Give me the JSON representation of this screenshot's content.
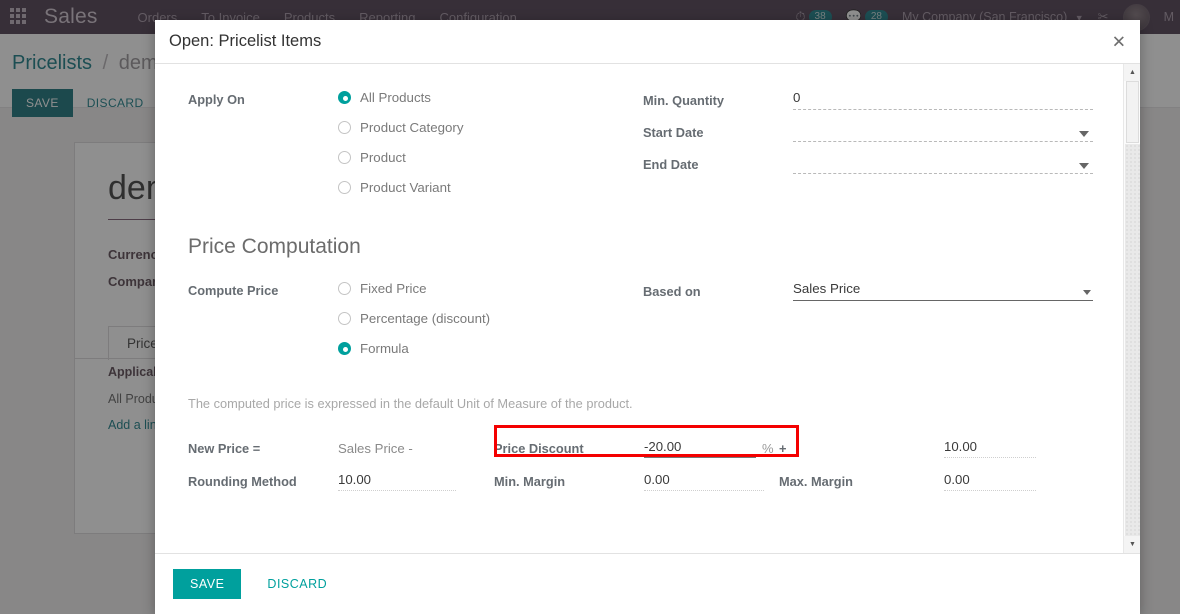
{
  "topbar": {
    "apps_icon": "apps-grid-icon",
    "brand": "Sales",
    "menu": [
      "Orders",
      "To Invoice",
      "Products",
      "Reporting",
      "Configuration"
    ],
    "activity_count": "38",
    "messages_count": "28",
    "company": "My Company (San Francisco)",
    "shortcut_glyph": "✂",
    "user": "M"
  },
  "breadcrumb": {
    "root": "Pricelists",
    "separator": "/",
    "current": "demo",
    "save_label": "SAVE",
    "discard_label": "DISCARD"
  },
  "record": {
    "title": "demo",
    "currency_label": "Currency",
    "company_label": "Company",
    "tab_label": "Price Rules",
    "column_header": "Applicable On",
    "row_value": "All Products",
    "add_line": "Add a line",
    "trash_icon": "trash-icon"
  },
  "modal": {
    "title": "Open: Pricelist Items",
    "close_icon": "close-icon",
    "apply_on": {
      "label": "Apply On",
      "options": [
        {
          "label": "All Products",
          "selected": true
        },
        {
          "label": "Product Category",
          "selected": false
        },
        {
          "label": "Product",
          "selected": false
        },
        {
          "label": "Product Variant",
          "selected": false
        }
      ]
    },
    "min_quantity": {
      "label": "Min. Quantity",
      "value": "0"
    },
    "start_date": {
      "label": "Start Date",
      "value": "",
      "dropdown_icon": "calendar-dropdown-icon"
    },
    "end_date": {
      "label": "End Date",
      "value": "",
      "dropdown_icon": "calendar-dropdown-icon"
    },
    "price_computation": {
      "section_title": "Price Computation",
      "compute_price": {
        "label": "Compute Price",
        "options": [
          {
            "label": "Fixed Price",
            "selected": false
          },
          {
            "label": "Percentage (discount)",
            "selected": false
          },
          {
            "label": "Formula",
            "selected": true
          }
        ]
      },
      "based_on": {
        "label": "Based on",
        "value": "Sales Price",
        "dropdown_icon": "chevron-down-icon"
      },
      "note": "The computed price is expressed in the default Unit of Measure of the product.",
      "formula": {
        "new_price_label": "New Price =",
        "sales_price_label": "Sales Price -",
        "price_discount_label": "Price Discount",
        "price_discount_value": "-20.00",
        "percent_symbol": "%",
        "plus_label": "+",
        "plus_value": "10.00",
        "rounding_method_label": "Rounding Method",
        "rounding_method_value": "10.00",
        "min_margin_label": "Min. Margin",
        "min_margin_value": "0.00",
        "max_margin_label": "Max. Margin",
        "max_margin_value": "0.00"
      }
    },
    "footer": {
      "save_label": "SAVE",
      "discard_label": "DISCARD"
    },
    "scrollbar": {
      "up_arrow": "▲",
      "down_arrow": "▼"
    }
  },
  "colors": {
    "accent_teal": "#00a09d",
    "brand_dark": "#3c2c3e",
    "highlight_red": "#f40000",
    "link_teal": "#00707a"
  }
}
